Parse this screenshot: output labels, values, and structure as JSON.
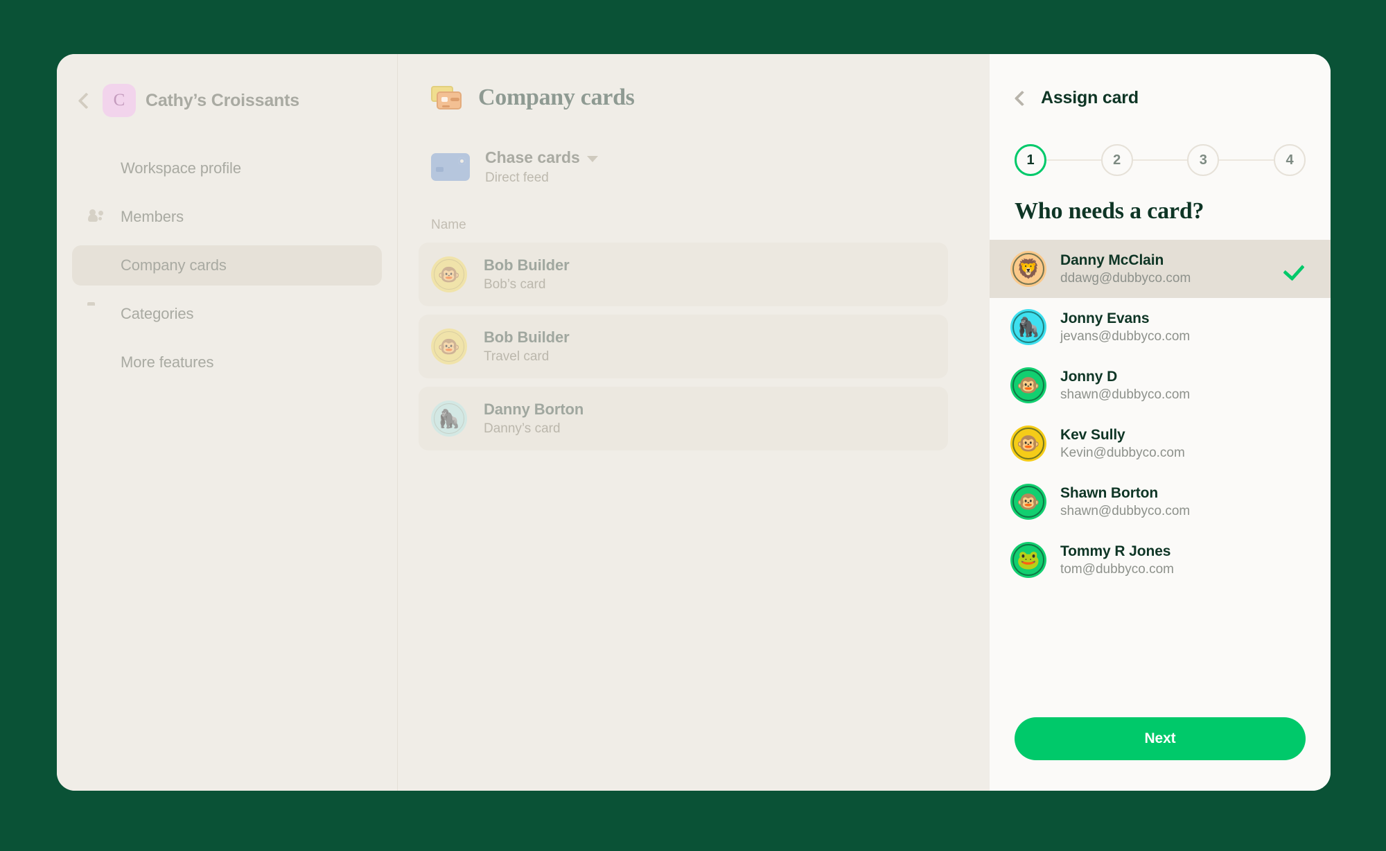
{
  "theme": {
    "page_bg": "#0a5236",
    "card_bg": "#f0ede7",
    "panel_bg": "#fbfaf8",
    "accent_green": "#00c96a",
    "dark_green_text": "#0e3525"
  },
  "sidebar": {
    "back_icon": "chevron-left-icon",
    "workspace_initial": "C",
    "workspace_name": "Cathy’s Croissants",
    "items": [
      {
        "label": "Workspace profile",
        "icon": "building-icon",
        "active": false
      },
      {
        "label": "Members",
        "icon": "people-icon",
        "active": false
      },
      {
        "label": "Company cards",
        "icon": "credit-card-icon",
        "active": true
      },
      {
        "label": "Categories",
        "icon": "folder-icon",
        "active": false
      },
      {
        "label": "More features",
        "icon": "gear-icon",
        "active": false
      }
    ]
  },
  "main": {
    "title": "Company cards",
    "title_icon": "stacked-cards-icon",
    "feed": {
      "icon": "bank-card-icon",
      "name": "Chase cards",
      "caret": "chevron-down-icon",
      "subtitle": "Direct feed"
    },
    "column_header": "Name",
    "rows": [
      {
        "name": "Bob Builder",
        "card": "Bob’s card",
        "avatar_color": "#f5e07e",
        "avatar_glyph": "🐵"
      },
      {
        "name": "Bob Builder",
        "card": "Travel card",
        "avatar_color": "#f5e07e",
        "avatar_glyph": "🐵"
      },
      {
        "name": "Danny Borton",
        "card": "Danny’s card",
        "avatar_color": "#bfe8e8",
        "avatar_glyph": "🦍"
      }
    ]
  },
  "panel": {
    "back_icon": "chevron-left-icon",
    "title": "Assign card",
    "steps": [
      {
        "number": "1",
        "active": true
      },
      {
        "number": "2",
        "active": false
      },
      {
        "number": "3",
        "active": false
      },
      {
        "number": "4",
        "active": false
      }
    ],
    "question": "Who needs a card?",
    "people": [
      {
        "name": "Danny McClain",
        "email": "ddawg@dubbyco.com",
        "avatar_color": "#fbc98a",
        "avatar_glyph": "🦁",
        "selected": true
      },
      {
        "name": "Jonny Evans",
        "email": "jevans@dubbyco.com",
        "avatar_color": "#3ee0f0",
        "avatar_glyph": "🦍",
        "selected": false
      },
      {
        "name": "Jonny D",
        "email": "shawn@dubbyco.com",
        "avatar_color": "#12cf70",
        "avatar_glyph": "🐵",
        "selected": false
      },
      {
        "name": "Kev Sully",
        "email": "Kevin@dubbyco.com",
        "avatar_color": "#f5cc18",
        "avatar_glyph": "🐵",
        "selected": false
      },
      {
        "name": "Shawn Borton",
        "email": "shawn@dubbyco.com",
        "avatar_color": "#12cf70",
        "avatar_glyph": "🐵",
        "selected": false
      },
      {
        "name": "Tommy R Jones",
        "email": "tom@dubbyco.com",
        "avatar_color": "#12cf70",
        "avatar_glyph": "🐸",
        "selected": false
      }
    ],
    "check_icon": "check-icon",
    "next_label": "Next"
  }
}
